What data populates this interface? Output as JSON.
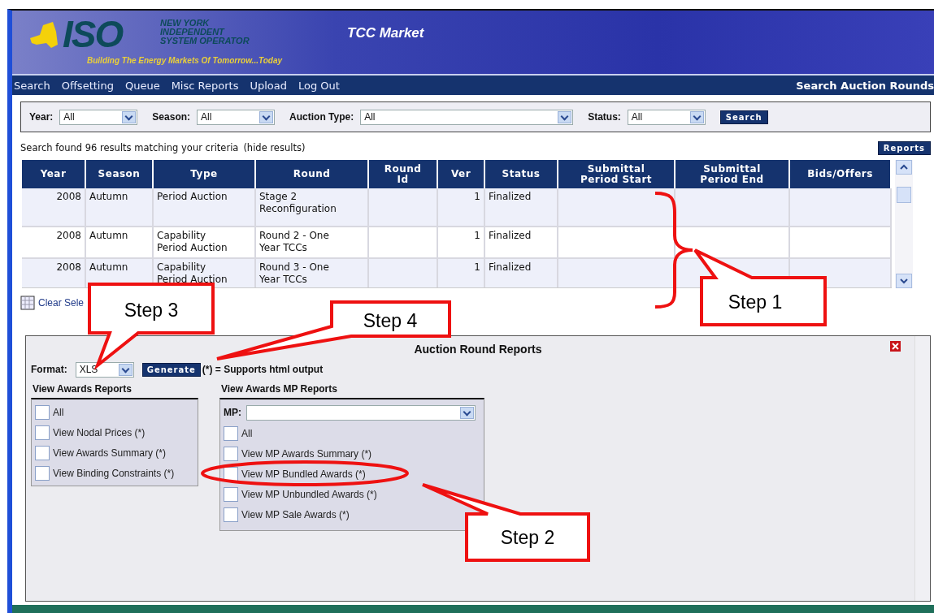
{
  "header": {
    "logo_text": "ISO",
    "org_name": [
      "NEW YORK",
      "INDEPENDENT",
      "SYSTEM OPERATOR"
    ],
    "tagline": "Building The Energy Markets Of Tomorrow...Today",
    "app_title": "TCC Market"
  },
  "nav": {
    "items": [
      "Search",
      "Offsetting",
      "Queue",
      "Misc Reports",
      "Upload",
      "Log Out"
    ],
    "page_title": "Search Auction Rounds"
  },
  "filters": [
    {
      "label": "Year:",
      "value": "All",
      "kind": "short"
    },
    {
      "label": "Season:",
      "value": "All",
      "kind": "short"
    },
    {
      "label": "Auction Type:",
      "value": "All",
      "kind": "wide"
    },
    {
      "label": "Status:",
      "value": "All",
      "kind": "short"
    }
  ],
  "search_button": "Search",
  "results": {
    "text": "Search found 96 results matching your criteria",
    "link": "(hide results)"
  },
  "reports_button": "Reports",
  "table": {
    "columns": [
      [
        "Year"
      ],
      [
        "Season"
      ],
      [
        "Type"
      ],
      [
        "Round"
      ],
      [
        "Round",
        "Id"
      ],
      [
        "Ver"
      ],
      [
        "Status"
      ],
      [
        "Submittal",
        "Period Start"
      ],
      [
        "Submittal",
        "Period End"
      ],
      [
        "Bids/Offers"
      ]
    ],
    "rows": [
      {
        "year": "2008",
        "season": "Autumn",
        "type": [
          "Period Auction"
        ],
        "round": [
          "Stage 2",
          "Reconfiguration"
        ],
        "ver": "1",
        "status": "Finalized",
        "selected": false
      },
      {
        "year": "2008",
        "season": "Autumn",
        "type": [
          "Capability",
          "Period Auction"
        ],
        "round": [
          "Round 2 - One",
          "Year TCCs"
        ],
        "ver": "1",
        "status": "Finalized",
        "selected": false
      },
      {
        "year": "2008",
        "season": "Autumn",
        "type": [
          "Capability",
          "Period Auction"
        ],
        "round": [
          "Round 3 - One",
          "Year TCCs"
        ],
        "ver": "1",
        "status": "Finalized",
        "selected": false
      }
    ]
  },
  "clear_selection": "Clear Sele",
  "reports_panel": {
    "title": "Auction Round Reports",
    "format_label": "Format:",
    "format_value": "XLS",
    "generate_button": "Generate",
    "note": "(*) = Supports html output",
    "awards": {
      "title": "View Awards Reports",
      "items": [
        {
          "label": "All",
          "checked": false
        },
        {
          "label": "View Nodal Prices (*)",
          "checked": false
        },
        {
          "label": "View Awards Summary (*)",
          "checked": false
        },
        {
          "label": "View Binding Constraints (*)",
          "checked": false
        }
      ]
    },
    "mp": {
      "title": "View Awards MP Reports",
      "mp_label": "MP:",
      "items": [
        {
          "label": "All",
          "checked": false
        },
        {
          "label": "View MP Awards Summary (*)",
          "checked": false
        },
        {
          "label": "View MP Bundled Awards (*)",
          "checked": false
        },
        {
          "label": "View MP Unbundled Awards (*)",
          "checked": false
        },
        {
          "label": "View MP Sale Awards (*)",
          "checked": false
        }
      ]
    }
  },
  "callouts": [
    "Step 3",
    "Step 4",
    "Step 1",
    "Step 2"
  ]
}
